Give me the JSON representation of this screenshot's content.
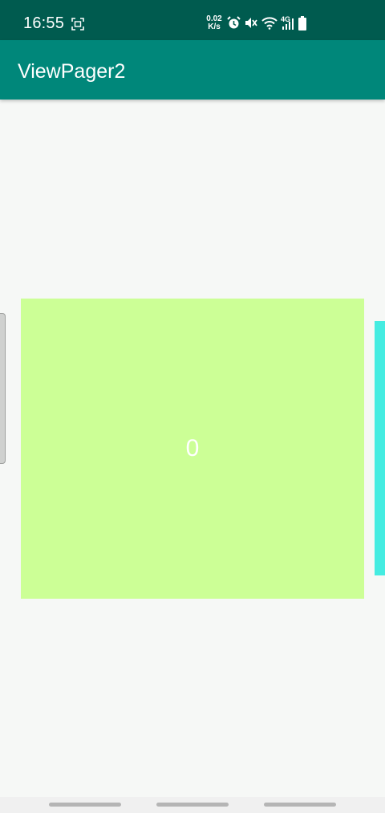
{
  "status_bar": {
    "time": "16:55",
    "net_speed_value": "0.02",
    "net_speed_unit": "K/s",
    "network_type": "4G",
    "icons": [
      "screenshot-icon",
      "alarm-icon",
      "mute-icon",
      "wifi-icon",
      "signal-icon",
      "battery-icon"
    ]
  },
  "toolbar": {
    "title": "ViewPager2"
  },
  "pager": {
    "current_page_label": "0",
    "colors": {
      "previous_page": "#cfd1cf",
      "current_page": "#ccff96",
      "next_page": "#45ece1"
    }
  },
  "theme": {
    "status_bar": "#005b4f",
    "toolbar": "#00877a",
    "background": "#f6f8f6"
  }
}
